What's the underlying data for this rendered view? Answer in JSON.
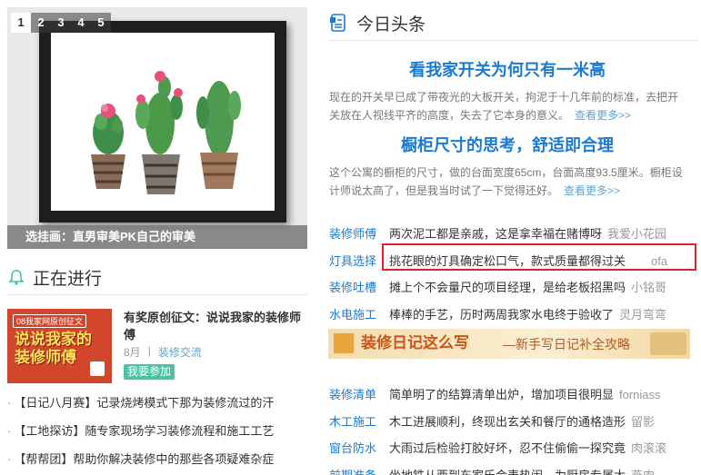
{
  "slider": {
    "tabs": [
      "1",
      "2",
      "3",
      "4",
      "5"
    ],
    "active_tab": 1,
    "caption": "选挂画：直男审美PK自己的审美"
  },
  "ongoing": {
    "title": "正在进行",
    "feature": {
      "image_badge": "08我家网原创征文",
      "image_text": "说说我家的装修师傅",
      "title": "有奖原创征文：说说我家的装修师傅",
      "month": "8月",
      "category": "装修交流",
      "join_label": "我要参加"
    },
    "items": [
      "【日记八月赛】记录烧烤模式下那为装修流过的汗",
      "【工地探访】随专家现场学习装修流程和施工工艺",
      "【帮帮团】帮助你解决装修中的那些各项疑难杂症"
    ]
  },
  "headlines": {
    "title": "今日头条",
    "articles": [
      {
        "title": "看我家开关为何只有一米高",
        "body": "现在的开关早已成了带夜光的大板开关，拘泥于十几年前的标准，去把开关放在人视线平齐的高度，失去了它本身的意义。",
        "more": "查看更多>>"
      },
      {
        "title": "橱柜尺寸的思考，舒适即合理",
        "body": "这个公寓的橱柜的尺寸，做的台面宽度65cm，台面高度93.5厘米。橱柜设计师说太高了，但是我当时试了一下觉得还好。",
        "more": "查看更多>>"
      }
    ]
  },
  "news": [
    {
      "category": "装修师傅",
      "text": "两次泥工都是亲戚，这是拿幸福在赌博呀",
      "author": "我爱小花园"
    },
    {
      "category": "灯具选择",
      "text": "挑花眼的灯具确定松口气，款式质量都得过关",
      "author": "ofa"
    },
    {
      "category": "装修吐槽",
      "text": "摊上个不会量尺的项目经理，是给老板招黑吗",
      "author": "小铭哥"
    },
    {
      "category": "水电施工",
      "text": "棒棒的手艺，历时两周我家水电终于验收了",
      "author": "灵月弯弯"
    },
    {
      "category": "装修清单",
      "text": "简单明了的结算清单出炉，增加项目很明显",
      "author": "forniass"
    },
    {
      "category": "木工施工",
      "text": "木工进展顺利，终现出玄关和餐厅的通格造形",
      "author": "留影"
    },
    {
      "category": "窗台防水",
      "text": "大雨过后检验打胶好坏，忍不住偷偷一探究竟",
      "author": "肉滚滚"
    },
    {
      "category": "前期准备",
      "text": "坐地铁从西到东家乐会表热闹，为厨房专属大",
      "author": "燕肉"
    }
  ],
  "banner": {
    "title": "装修日记这么写",
    "subtitle": "—新手写日记补全攻略"
  },
  "colors": {
    "link_blue": "#1a7ad1",
    "highlight_red": "#e0242a",
    "join_green": "#4cc2a5"
  }
}
